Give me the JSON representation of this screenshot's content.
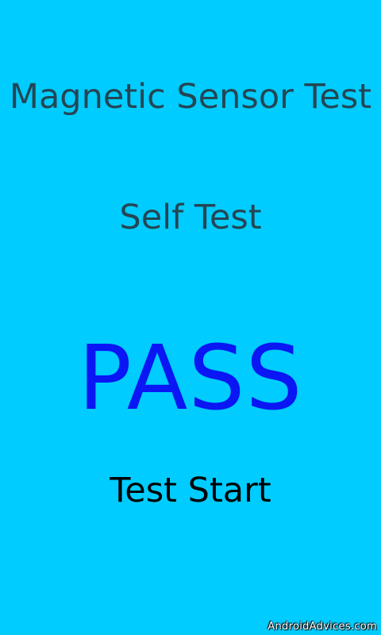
{
  "colors": {
    "background": "#00ccff",
    "label_text": "#244654",
    "result_text": "#0a16f3",
    "button_text": "#000000",
    "watermark_text": "#ffffff"
  },
  "screen": {
    "title": "Magnetic Sensor Test",
    "subtitle": "Self Test",
    "result": "PASS",
    "start_button": "Test Start"
  },
  "watermark": "AndroidAdvices.com"
}
